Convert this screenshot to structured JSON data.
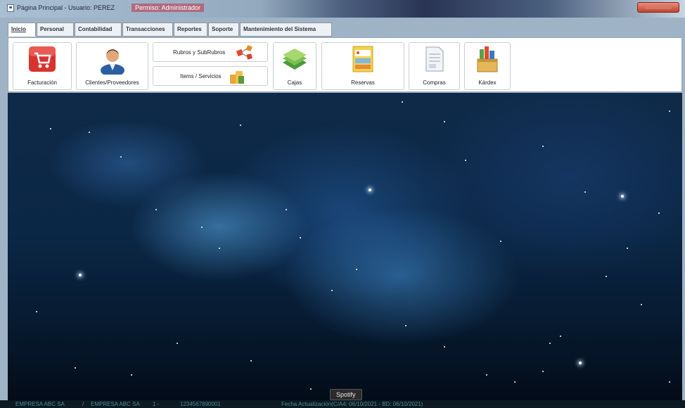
{
  "window": {
    "title": "Página Principal - Usuario: PEREZ",
    "permission": "Permiso: Administrador"
  },
  "menu": {
    "tabs": [
      "Inicio",
      "Personal",
      "Contabilidad",
      "Transacciones",
      "Reportes",
      "Soporte",
      "Mantenimiento del Sistema"
    ]
  },
  "toolbar": {
    "facturacion": "Facturación",
    "clientes": "Clientes/Proveedores",
    "rubros": "Rubros y SubRubros",
    "items": "Items / Servicios",
    "cajas": "Cajas",
    "reservas": "Reservas",
    "compras": "Compras",
    "kardex": "Kárdex"
  },
  "status": {
    "company": "EMPRESA ABC SA",
    "company2": "EMPRESA ABC SA",
    "ruc": "1234567890001",
    "update": "Fecha Actualización(C/A4: 06/10/2021 - BD: 06/10/2021)"
  },
  "tooltip": {
    "text": "Spotify"
  },
  "icons": {
    "facturacion": "shopping-cart-icon",
    "clientes": "user-icon",
    "rubros": "categories-icon",
    "items": "boxes-icon",
    "cajas": "money-icon",
    "reservas": "calendar-icon",
    "compras": "document-icon",
    "kardex": "inventory-icon"
  }
}
